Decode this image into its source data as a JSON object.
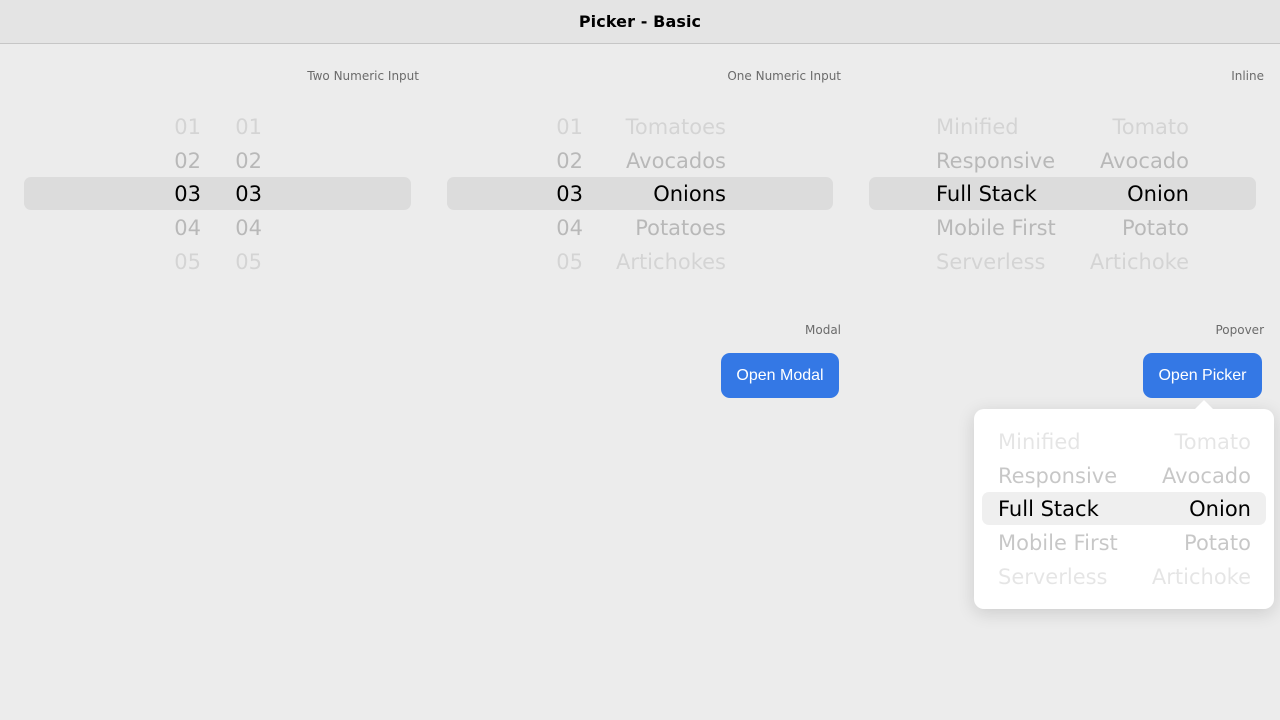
{
  "title": "Picker - Basic",
  "sections": {
    "two_numeric": {
      "label": "Two Numeric Input",
      "col1": [
        "01",
        "02",
        "03",
        "04",
        "05"
      ],
      "col2": [
        "01",
        "02",
        "03",
        "04",
        "05"
      ],
      "selected_index": 2
    },
    "one_numeric": {
      "label": "One Numeric Input",
      "col1": [
        "01",
        "02",
        "03",
        "04",
        "05"
      ],
      "col2": [
        "Tomatoes",
        "Avocados",
        "Onions",
        "Potatoes",
        "Artichokes"
      ],
      "selected_index": 2
    },
    "inline": {
      "label": "Inline",
      "col1": [
        "Minified",
        "Responsive",
        "Full Stack",
        "Mobile First",
        "Serverless"
      ],
      "col2": [
        "Tomato",
        "Avocado",
        "Onion",
        "Potato",
        "Artichoke"
      ],
      "selected_index": 2
    },
    "modal": {
      "label": "Modal",
      "button_label": "Open Modal"
    },
    "popover": {
      "label": "Popover",
      "button_label": "Open Picker",
      "col1": [
        "Minified",
        "Responsive",
        "Full Stack",
        "Mobile First",
        "Serverless"
      ],
      "col2": [
        "Tomato",
        "Avocado",
        "Onion",
        "Potato",
        "Artichoke"
      ],
      "selected_index": 2
    }
  },
  "colors": {
    "accent": "#3478e5",
    "background": "#ececec",
    "titlebar": "#e4e4e4",
    "highlight": "#dcdcdc"
  }
}
